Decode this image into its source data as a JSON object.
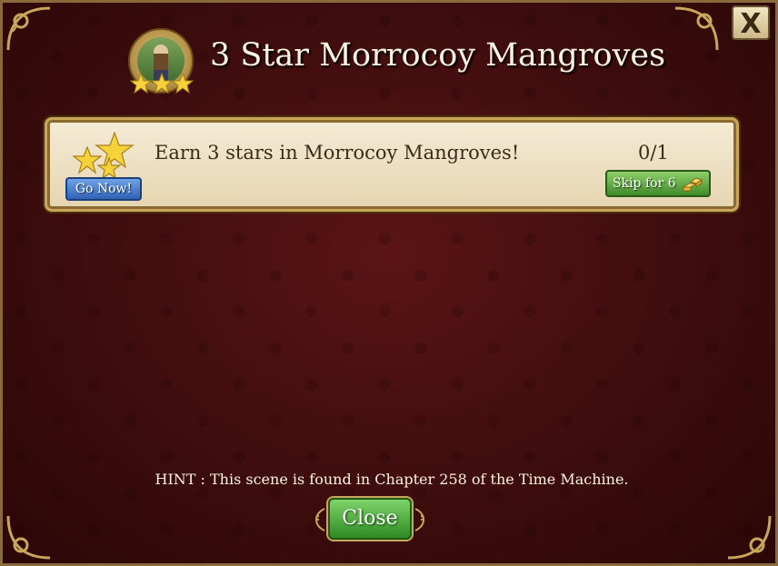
{
  "dialog": {
    "title": "3 Star Morrocoy Mangroves",
    "close_x_label": "X"
  },
  "quest": {
    "description": "Earn 3 stars in Morrocoy Mangroves!",
    "progress": "0/1",
    "go_now_label": "Go Now!",
    "skip_label": "Skip for 6"
  },
  "footer": {
    "hint": "HINT : This scene is found in Chapter 258 of the Time Machine.",
    "close_label": "Close"
  },
  "icons": {
    "medal": "scene-medal-icon",
    "stars": "three-stars-icon",
    "gold": "gold-bars-icon"
  },
  "colors": {
    "background": "#3e0d0d",
    "go_button": "#2f62b5",
    "skip_button": "#3f8a2a",
    "close_button": "#2f8a24"
  }
}
